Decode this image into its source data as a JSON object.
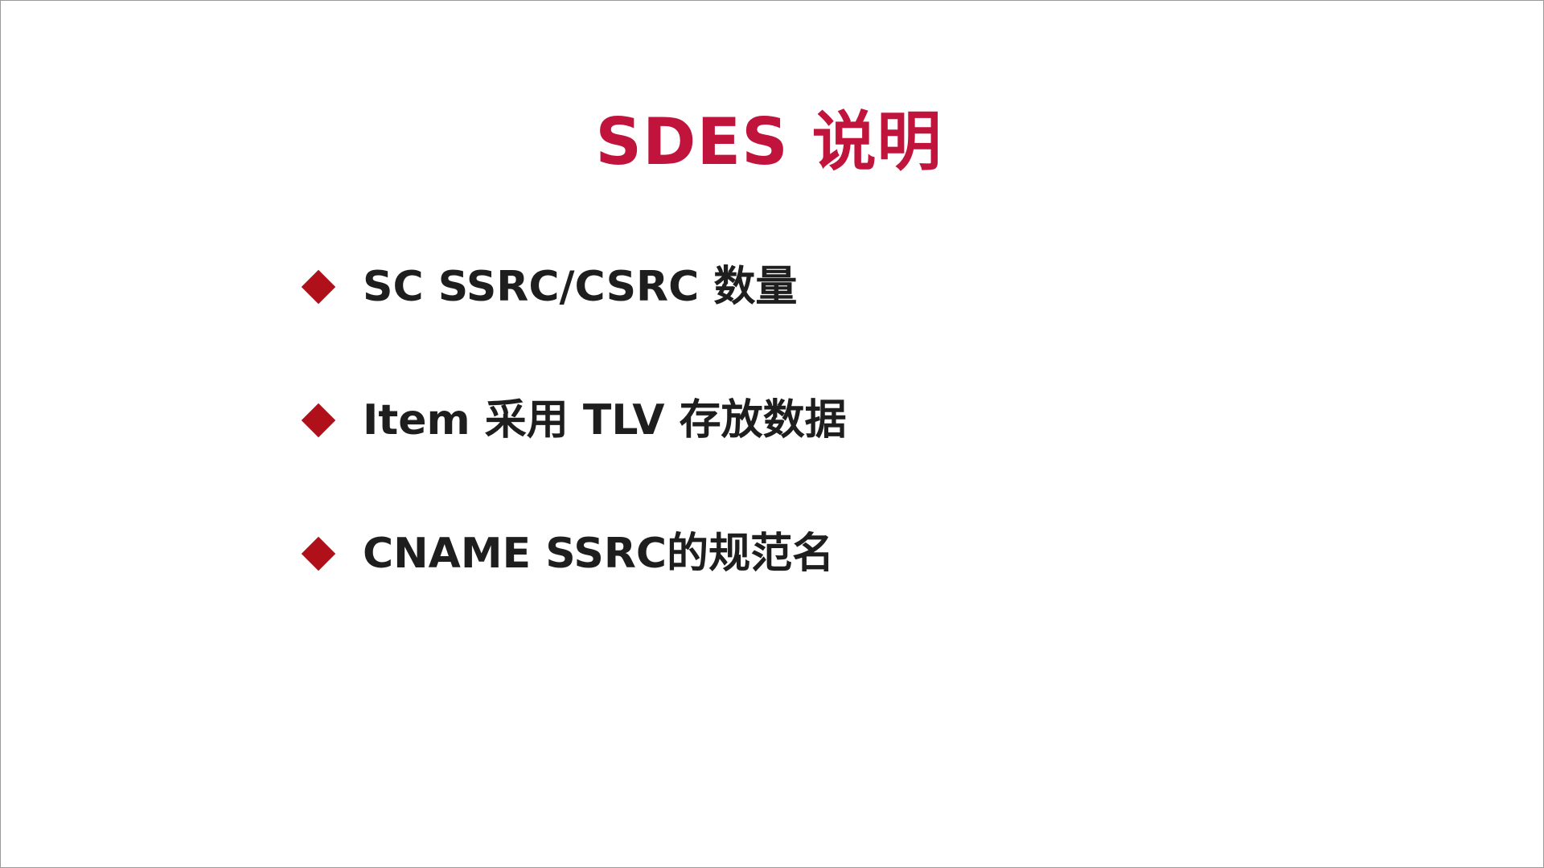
{
  "slide": {
    "title": "SDES 说明",
    "bullets": [
      {
        "text": "SC SSRC/CSRC 数量"
      },
      {
        "text": "Item 采用 TLV 存放数据"
      },
      {
        "text": "CNAME SSRC的规范名"
      }
    ],
    "colors": {
      "title": "#c0143c",
      "bullet_marker": "#b0101a",
      "text": "#1e1e1e",
      "background": "#ffffff"
    },
    "icons": {
      "bullet_marker": "diamond-icon"
    }
  }
}
